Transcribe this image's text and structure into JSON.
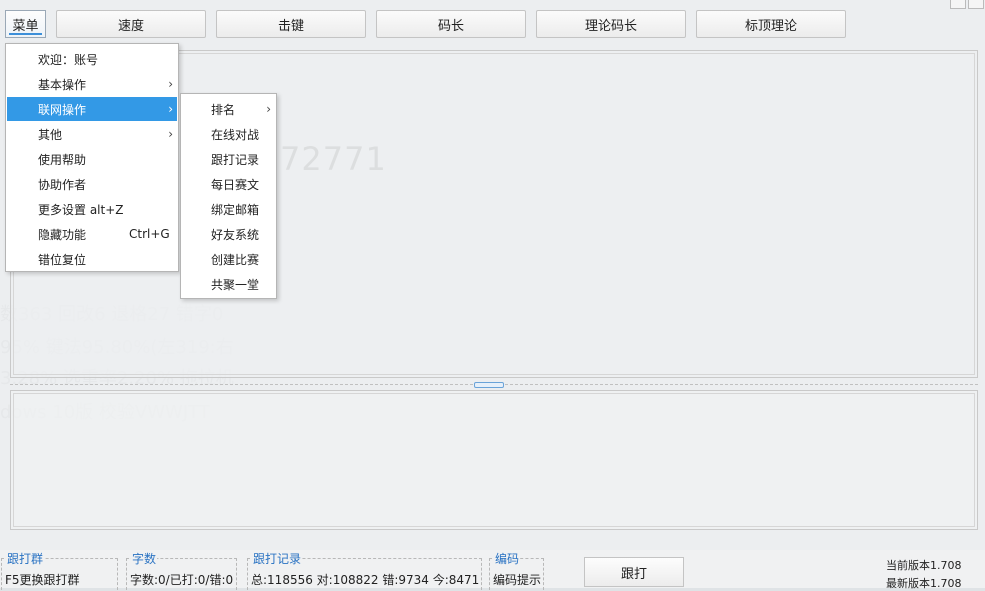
{
  "topbar": {
    "menu_label": "菜单",
    "buttons": [
      "速度",
      "击键",
      "码长",
      "理论码长",
      "标顶理论"
    ]
  },
  "menu": {
    "items": [
      {
        "label": "欢迎：账号",
        "shortcut": "",
        "submenu": false
      },
      {
        "label": "基本操作",
        "shortcut": "",
        "submenu": true
      },
      {
        "label": "联网操作",
        "shortcut": "",
        "submenu": true,
        "active": true
      },
      {
        "label": "其他",
        "shortcut": "",
        "submenu": true
      },
      {
        "label": "使用帮助",
        "shortcut": "",
        "submenu": false
      },
      {
        "label": "协助作者",
        "shortcut": "",
        "submenu": false
      },
      {
        "label": "更多设置 alt+Z",
        "shortcut": "",
        "submenu": false
      },
      {
        "label": "隐藏功能",
        "shortcut": "Ctrl+G",
        "submenu": false
      },
      {
        "label": "错位复位",
        "shortcut": "",
        "submenu": false
      }
    ]
  },
  "submenu": {
    "items": [
      {
        "label": "排名",
        "submenu": true
      },
      {
        "label": "在线对战",
        "submenu": false
      },
      {
        "label": "跟打记录",
        "submenu": false
      },
      {
        "label": "每日赛文",
        "submenu": false
      },
      {
        "label": "绑定邮箱",
        "submenu": false
      },
      {
        "label": "好友系统",
        "submenu": false
      },
      {
        "label": "创建比赛",
        "submenu": false
      },
      {
        "label": "共聚一堂",
        "submenu": false
      }
    ]
  },
  "background_text": {
    "number": "72771"
  },
  "status": {
    "group1_title": "跟打群",
    "group1_value": "F5更换跟打群",
    "group2_title": "字数",
    "group2_value": "字数:0/已打:0/错:0",
    "group3_title": "跟打记录",
    "group3_value": "总:118556 对:108822 错:9734 今:8471",
    "group4_title": "编码",
    "group4_value": "编码提示",
    "follow_button": "跟打",
    "current_version": "当前版本1.708",
    "latest_version": "最新版本1.708"
  },
  "colors": {
    "accent": "#3399e6",
    "group_title": "#2a73c3"
  }
}
